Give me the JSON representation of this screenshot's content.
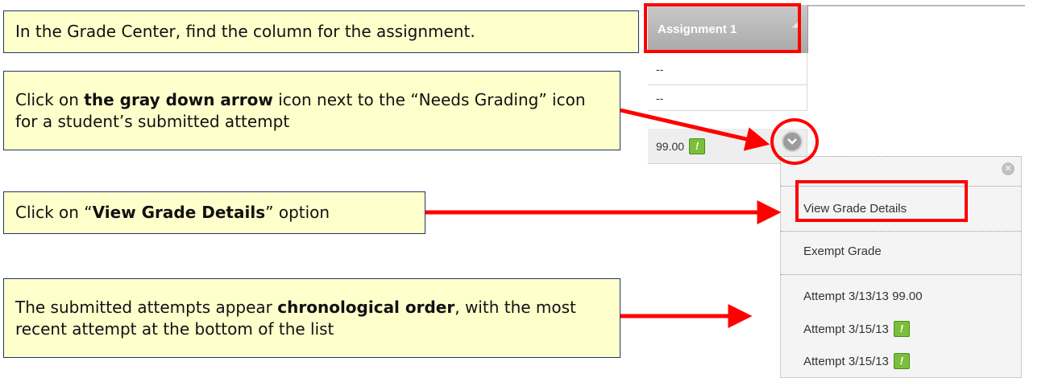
{
  "callouts": {
    "c1": "In the Grade Center, find the column for the assignment.",
    "c2_pre": "Click on ",
    "c2_bold": "the gray down arrow",
    "c2_post": " icon next to the “Needs Grading” icon for a student’s submitted attempt",
    "c3_pre": "Click on “",
    "c3_bold": "View Grade Details",
    "c3_post": "” option",
    "c4_pre": "The submitted attempts appear ",
    "c4_bold": "chronological order",
    "c4_post": ", with the most recent attempt at the bottom of the list"
  },
  "grade_center": {
    "column_header": "Assignment 1",
    "rows": [
      "--",
      "--",
      "99.00"
    ],
    "needs_grading_glyph": "!"
  },
  "menu": {
    "items": [
      {
        "label": "View Grade Details"
      },
      {
        "label": "Exempt Grade"
      },
      {
        "label": "Attempt 3/13/13 99.00"
      },
      {
        "label": "Attempt 3/15/13",
        "needs_grading": true
      },
      {
        "label": "Attempt 3/15/13",
        "needs_grading": true
      }
    ]
  },
  "colors": {
    "callout_bg": "#ffffcc",
    "callout_border": "#1f3864",
    "annotation_red": "#ff0000",
    "needs_grading_green": "#7bbf3a"
  },
  "icons": [
    "chevron-down-icon",
    "close-icon",
    "needs-grading-icon"
  ]
}
